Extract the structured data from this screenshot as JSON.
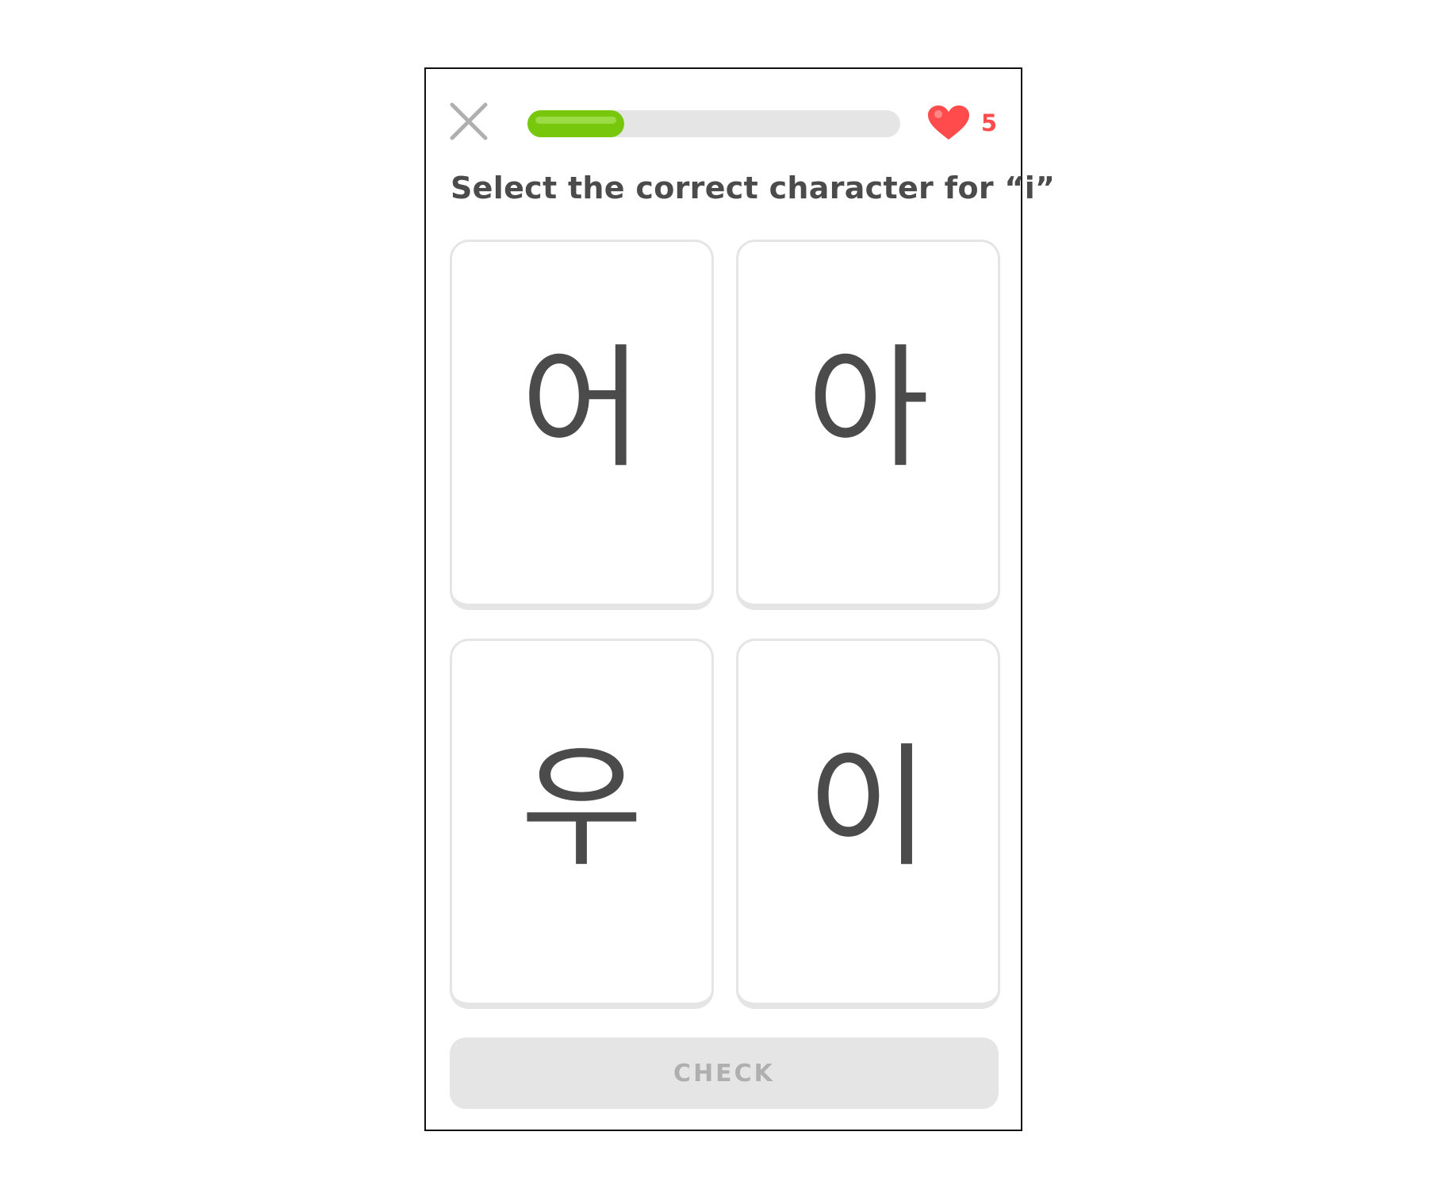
{
  "header": {
    "close_icon": "close-icon",
    "progress": 0.26,
    "hearts": {
      "icon": "heart-icon",
      "count": "5"
    }
  },
  "prompt": "Select the correct character for “i”",
  "choices": [
    {
      "character": "어"
    },
    {
      "character": "아"
    },
    {
      "character": "우"
    },
    {
      "character": "이"
    }
  ],
  "footer": {
    "check_label": "CHECK"
  },
  "colors": {
    "accent_green": "#77c70c",
    "heart_red": "#ff4b4b",
    "text_dark": "#4b4b4b",
    "disabled_gray": "#e5e5e5"
  }
}
